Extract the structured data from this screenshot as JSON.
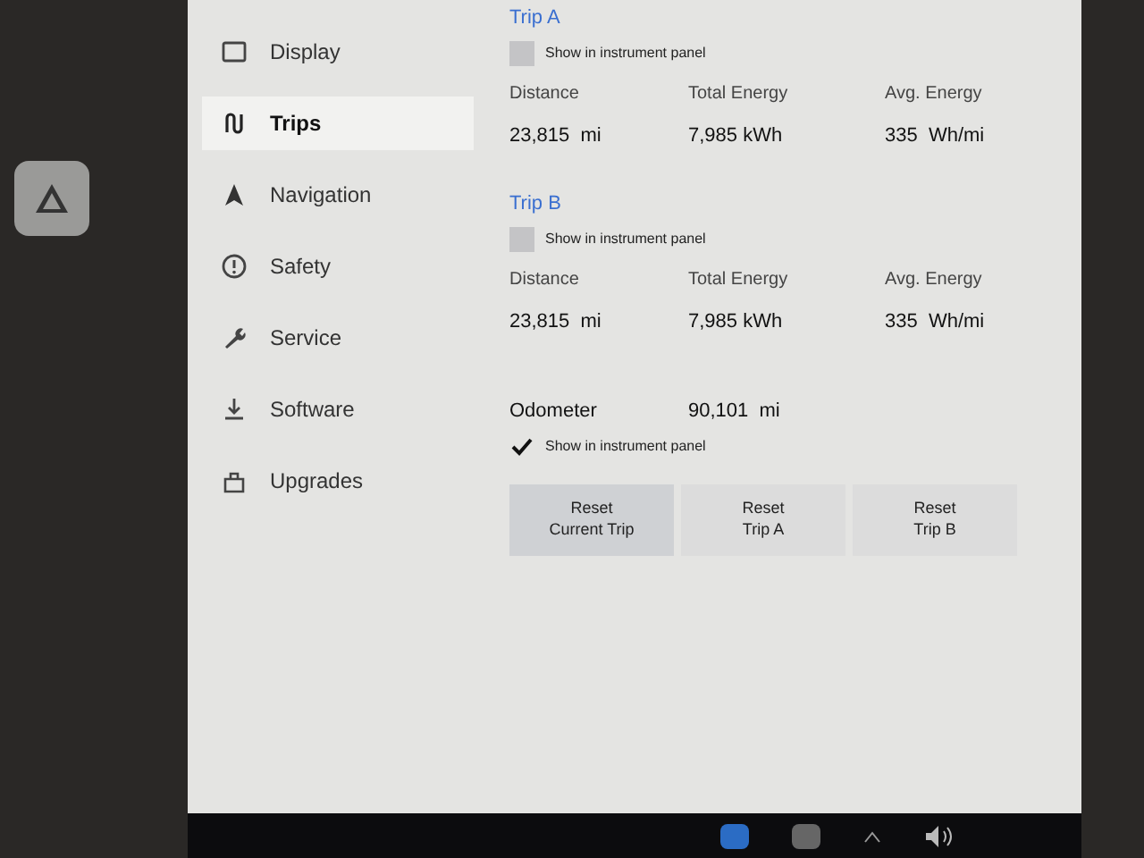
{
  "sidebar": {
    "items": [
      {
        "label": "Display",
        "selected": false
      },
      {
        "label": "Trips",
        "selected": true
      },
      {
        "label": "Navigation",
        "selected": false
      },
      {
        "label": "Safety",
        "selected": false
      },
      {
        "label": "Service",
        "selected": false
      },
      {
        "label": "Software",
        "selected": false
      },
      {
        "label": "Upgrades",
        "selected": false
      }
    ]
  },
  "trips": [
    {
      "title": "Trip A",
      "checkbox": {
        "label": "Show in instrument panel",
        "checked": false
      },
      "stats": [
        {
          "label": "Distance",
          "value": "23,815  mi"
        },
        {
          "label": "Total Energy",
          "value": "7,985 kWh"
        },
        {
          "label": "Avg. Energy",
          "value": "335  Wh/mi"
        }
      ]
    },
    {
      "title": "Trip B",
      "checkbox": {
        "label": "Show in instrument panel",
        "checked": false
      },
      "stats": [
        {
          "label": "Distance",
          "value": "23,815  mi"
        },
        {
          "label": "Total Energy",
          "value": "7,985 kWh"
        },
        {
          "label": "Avg. Energy",
          "value": "335  Wh/mi"
        }
      ]
    }
  ],
  "odometer": {
    "label": "Odometer",
    "value": "90,101  mi",
    "checkbox": {
      "label": "Show in instrument panel",
      "checked": true
    }
  },
  "buttons": [
    {
      "label": "Reset\nCurrent Trip",
      "selected": true
    },
    {
      "label": "Reset\nTrip A",
      "selected": false
    },
    {
      "label": "Reset\nTrip B",
      "selected": false
    }
  ]
}
